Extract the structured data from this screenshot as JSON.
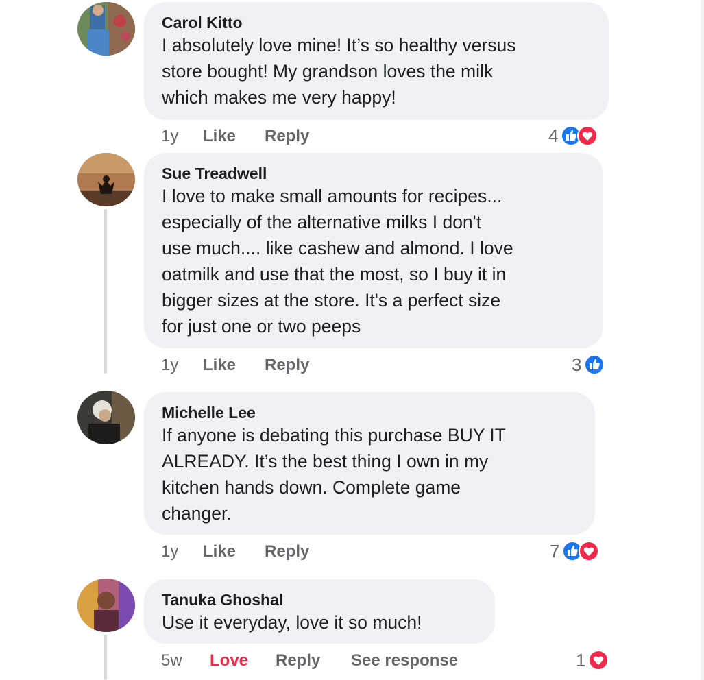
{
  "comments": [
    {
      "author": "Carol Kitto",
      "text": "I absolutely love mine! It’s so healthy versus\nstore bought! My grandson loves the milk\nwhich makes me very happy!",
      "time": "1y",
      "like_label": "Like",
      "reply_label": "Reply",
      "reaction_count": "4",
      "reactions": [
        "like-reaction-icon",
        "love-reaction-icon"
      ]
    },
    {
      "author": "Sue Treadwell",
      "text": "I love to make small amounts for recipes...\nespecially of the alternative milks I don't\nuse much.... like cashew and almond. I love\noatmilk and use that the most, so I buy it in\nbigger sizes at the store. It's a perfect size\nfor just one or two peeps",
      "time": "1y",
      "like_label": "Like",
      "reply_label": "Reply",
      "reaction_count": "3",
      "reactions": [
        "like-reaction-icon"
      ]
    },
    {
      "author": "Michelle Lee",
      "text": "If anyone is debating this purchase BUY IT\nALREADY. It’s the best thing I own in my\nkitchen hands down. Complete game\nchanger.",
      "time": "1y",
      "like_label": "Like",
      "reply_label": "Reply",
      "reaction_count": "7",
      "reactions": [
        "like-reaction-icon",
        "love-reaction-icon"
      ]
    },
    {
      "author": "Tanuka Ghoshal",
      "text": "Use it everyday, love it so much!",
      "time": "5w",
      "love_label": "Love",
      "reply_label": "Reply",
      "see_response_label": "See response",
      "reaction_count": "1",
      "reactions": [
        "love-reaction-icon"
      ]
    }
  ],
  "colors": {
    "bubble": "#eff1f4",
    "action_text": "#65676b",
    "like_blue": "#1877f2",
    "love_red": "#f02849"
  }
}
